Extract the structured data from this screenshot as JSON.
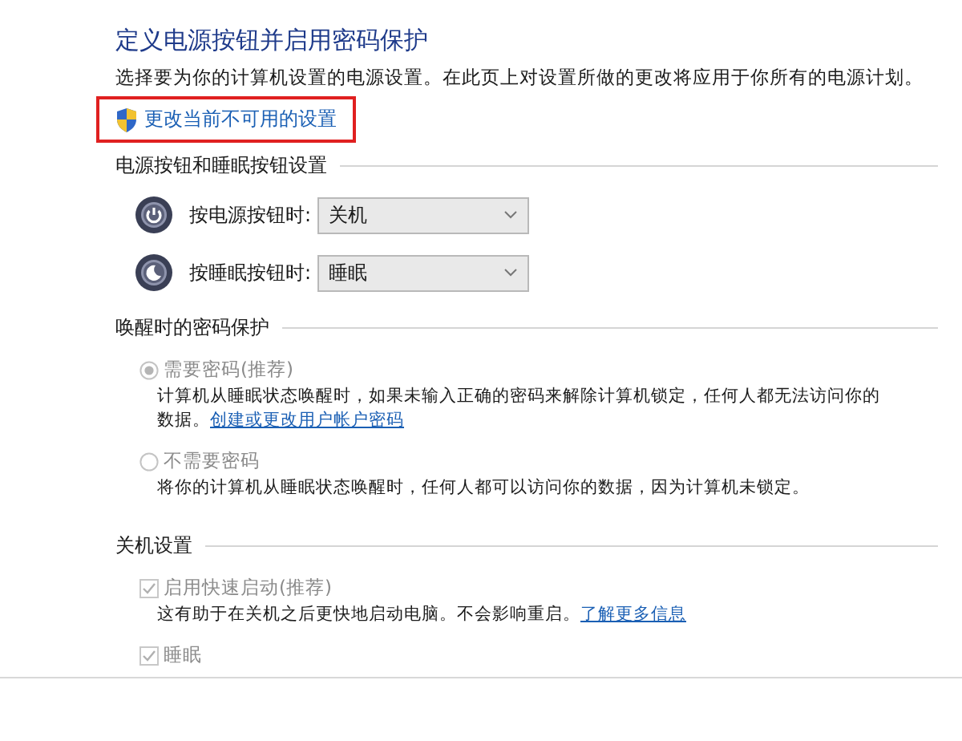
{
  "title": "定义电源按钮并启用密码保护",
  "description": "选择要为你的计算机设置的电源设置。在此页上对设置所做的更改将应用于你所有的电源计划。",
  "admin_link": {
    "text": "更改当前不可用的设置",
    "highlighted": true
  },
  "sections": [
    {
      "heading": "电源按钮和睡眠按钮设置",
      "kind": "dropdowns",
      "items": [
        {
          "kind": "power",
          "label": "按电源按钮时:",
          "value": "关机"
        },
        {
          "kind": "sleep",
          "label": "按睡眠按钮时:",
          "value": "睡眠"
        }
      ]
    },
    {
      "heading": "唤醒时的密码保护",
      "kind": "radios",
      "items": [
        {
          "label": "需要密码(推荐)",
          "selected": true,
          "disabled": true,
          "description": "计算机从睡眠状态唤醒时，如果未输入正确的密码来解除计算机锁定，任何人都无法访问你的数据。",
          "link": "创建或更改用户帐户密码"
        },
        {
          "label": "不需要密码",
          "selected": false,
          "disabled": true,
          "description": "将你的计算机从睡眠状态唤醒时，任何人都可以访问你的数据，因为计算机未锁定。"
        }
      ]
    },
    {
      "heading": "关机设置",
      "kind": "checkboxes",
      "items": [
        {
          "label": "启用快速启动(推荐)",
          "checked": true,
          "disabled": true,
          "description": "这有助于在关机之后更快地启动电脑。不会影响重启。",
          "link": "了解更多信息"
        },
        {
          "label": "睡眠",
          "checked": true,
          "disabled": true
        }
      ]
    }
  ]
}
